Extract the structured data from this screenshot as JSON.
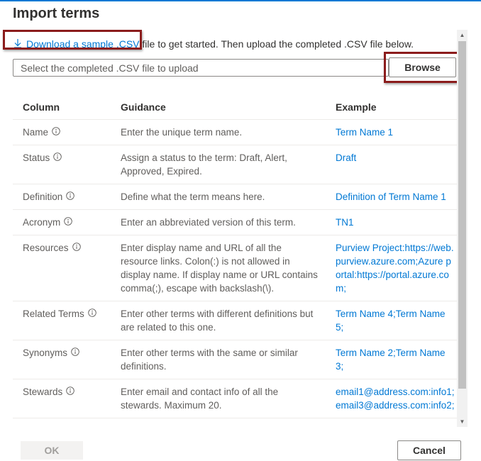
{
  "dialog": {
    "title": "Import terms"
  },
  "intro": {
    "link_text": "Download a sample .CSV",
    "rest_text": " file to get started. Then upload the completed .CSV file below."
  },
  "upload": {
    "placeholder": "Select the completed .CSV file to upload",
    "browse_label": "Browse"
  },
  "table": {
    "headers": [
      "Column",
      "Guidance",
      "Example"
    ],
    "rows": [
      {
        "column": "Name",
        "guidance": "Enter the unique term name.",
        "example": "Term Name 1"
      },
      {
        "column": "Status",
        "guidance": "Assign a status to the term: Draft, Alert, Approved, Expired.",
        "example": "Draft"
      },
      {
        "column": "Definition",
        "guidance": "Define what the term means here.",
        "example": "Definition of Term Name 1"
      },
      {
        "column": "Acronym",
        "guidance": "Enter an abbreviated version of this term.",
        "example": "TN1"
      },
      {
        "column": "Resources",
        "guidance": "Enter display name and URL of all the resource links. Colon(:) is not allowed in display name. If display name or URL contains comma(;), escape with backslash(\\).",
        "example": "Purview Project:https://web.purview.azure.com;Azure portal:https://portal.azure.com;"
      },
      {
        "column": "Related Terms",
        "guidance": "Enter other terms with different definitions but are related to this one.",
        "example": "Term Name 4;Term Name 5;"
      },
      {
        "column": "Synonyms",
        "guidance": "Enter other terms with the same or similar definitions.",
        "example": "Term Name 2;Term Name 3;"
      },
      {
        "column": "Stewards",
        "guidance": "Enter email and contact info of all the stewards. Maximum 20.",
        "example": "email1@address.com:info1;email3@address.com:info2;"
      }
    ]
  },
  "footer": {
    "ok_label": "OK",
    "cancel_label": "Cancel"
  },
  "colors": {
    "accent": "#0078d4",
    "highlight_box": "#8b1c1c"
  },
  "icons": {
    "download": "download-icon",
    "info": "info-icon",
    "scroll_up": "chevron-up-icon",
    "scroll_down": "chevron-down-icon"
  }
}
